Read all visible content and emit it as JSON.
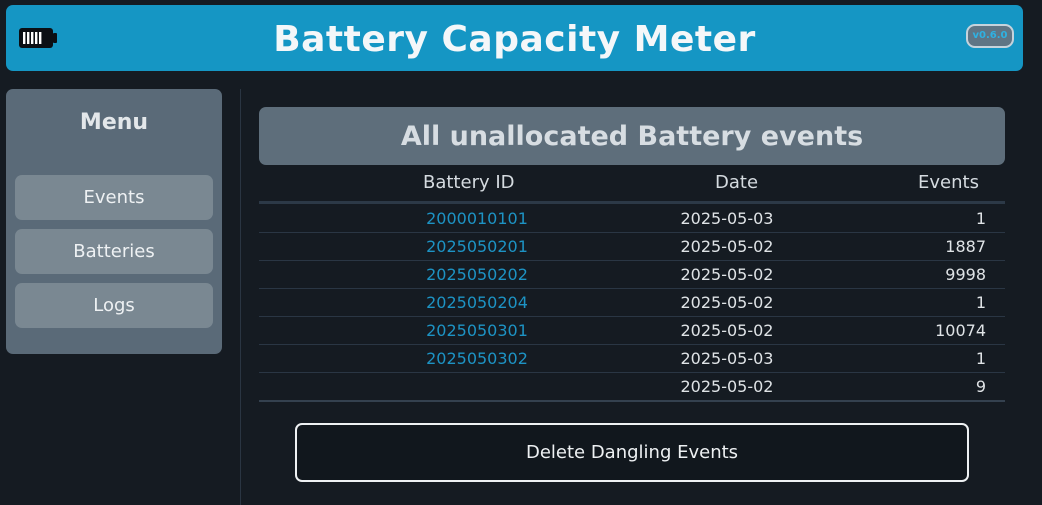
{
  "header": {
    "title": "Battery Capacity Meter",
    "version": "v0.6.0",
    "logo_icon": "battery-icon",
    "color": "#1596c4"
  },
  "sidebar": {
    "title": "Menu",
    "items": [
      {
        "label": "Events"
      },
      {
        "label": "Batteries"
      },
      {
        "label": "Logs"
      }
    ]
  },
  "main": {
    "panel_title": "All unallocated Battery events",
    "columns": [
      "Battery ID",
      "Date",
      "Events"
    ],
    "rows": [
      {
        "battery_id": "2000010101",
        "date": "2025-05-03",
        "events": "1"
      },
      {
        "battery_id": "2025050201",
        "date": "2025-05-02",
        "events": "1887"
      },
      {
        "battery_id": "2025050202",
        "date": "2025-05-02",
        "events": "9998"
      },
      {
        "battery_id": "2025050204",
        "date": "2025-05-02",
        "events": "1"
      },
      {
        "battery_id": "2025050301",
        "date": "2025-05-02",
        "events": "10074"
      },
      {
        "battery_id": "2025050302",
        "date": "2025-05-03",
        "events": "1"
      },
      {
        "battery_id": "",
        "date": "2025-05-02",
        "events": "9"
      }
    ],
    "delete_button_label": "Delete Dangling Events",
    "link_color": "#1d93c4"
  }
}
